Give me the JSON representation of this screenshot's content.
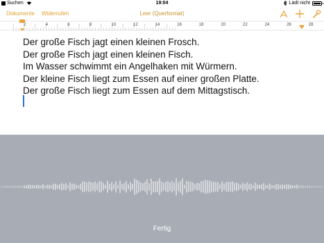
{
  "status_bar": {
    "back_label": "Suchen",
    "time": "19:04",
    "charging_label": "Lädt nicht"
  },
  "toolbar": {
    "documents_label": "Dokumente",
    "undo_label": "Widerrufen",
    "title": "Leer (Querformat)",
    "icons": [
      "brush-icon",
      "plus-icon",
      "wrench-icon"
    ]
  },
  "ruler": {
    "labels": [
      "2",
      "4",
      "6",
      "8",
      "10",
      "12",
      "14",
      "16",
      "18",
      "20",
      "22",
      "24",
      "26",
      "28"
    ]
  },
  "document": {
    "lines": [
      "Der große Fisch jagt einen kleinen Frosch.",
      "Der große Fisch jagt einen kleinen Fisch.",
      "Im Wasser schwimmt ein Angelhaken mit Würmern.",
      "Der kleine Fisch liegt zum Essen auf einer großen Platte.",
      "Der große Fisch liegt zum Essen auf dem Mittagstisch."
    ]
  },
  "dictation": {
    "done_label": "Fertig"
  },
  "colors": {
    "accent": "#e9a23b",
    "dictation_bg": "#a8adb5",
    "cursor": "#2b6fd6"
  }
}
